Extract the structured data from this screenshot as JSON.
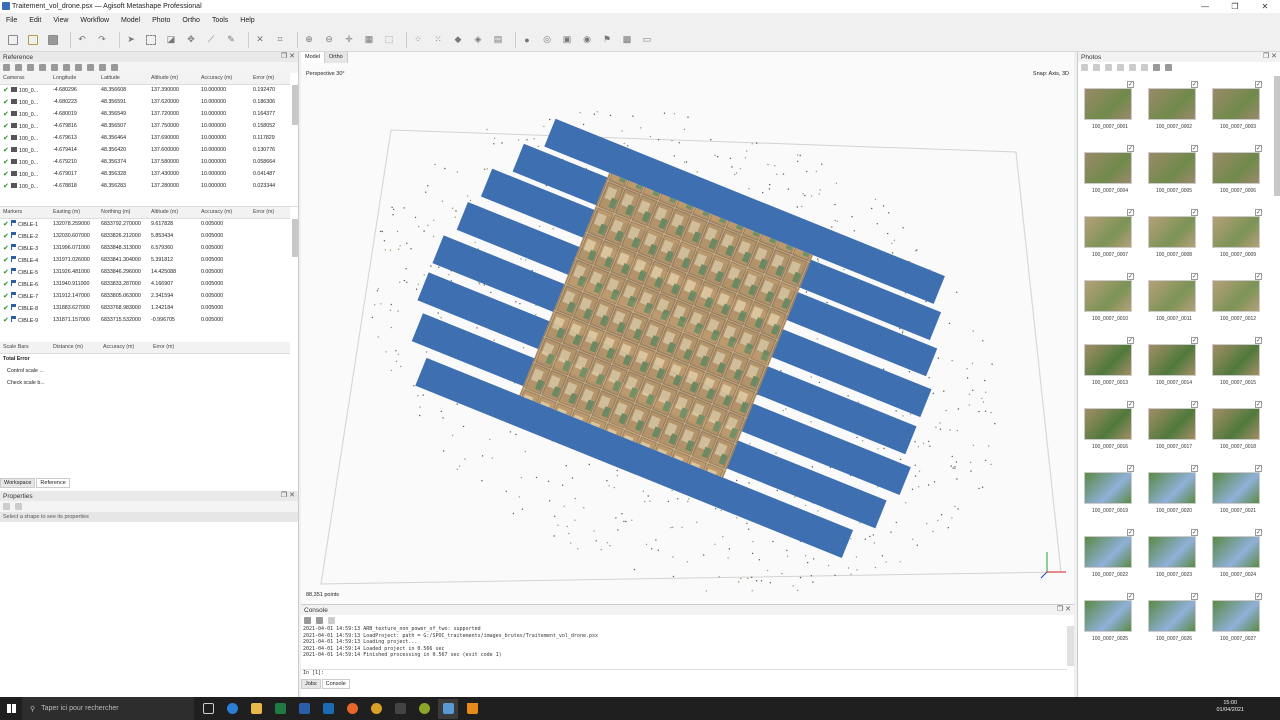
{
  "window": {
    "title": "Traitement_vol_drone.psx — Agisoft Metashape Professional",
    "minimize": "—",
    "maximize": "❐",
    "close": "✕"
  },
  "menu": [
    "File",
    "Edit",
    "View",
    "Workflow",
    "Model",
    "Photo",
    "Ortho",
    "Tools",
    "Help"
  ],
  "reference": {
    "title": "Reference",
    "cameras_headers": [
      "Cameras",
      "Longitude",
      "Latitude",
      "Altitude (m)",
      "Accuracy (m)",
      "Error (m)"
    ],
    "cameras": [
      [
        "100_0...",
        "-4.680296",
        "48.356608",
        "137.390000",
        "10.000000",
        "0.192470"
      ],
      [
        "100_0...",
        "-4.680223",
        "48.356591",
        "137.620000",
        "10.000000",
        "0.186306"
      ],
      [
        "100_0...",
        "-4.680019",
        "48.356549",
        "137.720000",
        "10.000000",
        "0.164377"
      ],
      [
        "100_0...",
        "-4.679816",
        "48.356507",
        "137.750000",
        "10.000000",
        "0.158052"
      ],
      [
        "100_0...",
        "-4.679613",
        "48.356464",
        "137.690000",
        "10.000000",
        "0.117829"
      ],
      [
        "100_0...",
        "-4.679414",
        "48.356420",
        "137.600000",
        "10.000000",
        "0.130776"
      ],
      [
        "100_0...",
        "-4.679210",
        "48.356374",
        "137.580000",
        "10.000000",
        "0.058664"
      ],
      [
        "100_0...",
        "-4.679017",
        "48.356328",
        "137.430000",
        "10.000000",
        "0.041487"
      ],
      [
        "100_0...",
        "-4.678818",
        "48.356283",
        "137.280000",
        "10.000000",
        "0.023344"
      ]
    ],
    "markers_headers": [
      "Markers",
      "Easting (m)",
      "Northing (m)",
      "Altitude (m)",
      "Accuracy (m)",
      "Error (m)"
    ],
    "markers": [
      [
        "CIBLE-1",
        "132078.259000",
        "6833792.270000",
        "9.617828",
        "0.005000",
        ""
      ],
      [
        "CIBLE-2",
        "132030.607000",
        "6833826.212000",
        "5.853434",
        "0.005000",
        ""
      ],
      [
        "CIBLE-3",
        "131996.071000",
        "6833848.313000",
        "6.579360",
        "0.005000",
        ""
      ],
      [
        "CIBLE-4",
        "131971.026000",
        "6833841.304000",
        "5.391812",
        "0.005000",
        ""
      ],
      [
        "CIBLE-5",
        "131926.481000",
        "6833846.296000",
        "14.425088",
        "0.005000",
        ""
      ],
      [
        "CIBLE-6",
        "131940.911000",
        "6833833.287000",
        "4.166907",
        "0.005000",
        ""
      ],
      [
        "CIBLE-7",
        "131912.147000",
        "6833805.063000",
        "2.341594",
        "0.005000",
        ""
      ],
      [
        "CIBLE-8",
        "131883.627000",
        "6833768.983000",
        "1.242184",
        "0.005000",
        ""
      ],
      [
        "CIBLE-9",
        "131871.157000",
        "6833715.532000",
        "-0.996705",
        "0.005000",
        ""
      ]
    ],
    "scalebars_headers": [
      "Scale Bars",
      "Distance (m)",
      "Accuracy (m)",
      "Error (m)"
    ],
    "total_error": "Total Error",
    "control_scale": "Control scale ...",
    "check_scale": "Check scale b..."
  },
  "left_tabs": [
    "Workspace",
    "Reference"
  ],
  "properties": {
    "title": "Properties",
    "hint": "Select a shape to see its properties"
  },
  "viewport": {
    "tabs": [
      "Model",
      "Ortho"
    ],
    "projection": "Perspective 30°",
    "snap": "Snap: Axis, 3D",
    "points": "88,351 points"
  },
  "console": {
    "title": "Console",
    "lines": [
      "2021-04-01 14:59:13 ARB_texture_non_power_of_two: supported",
      "2021-04-01 14:59:13 LoadProject: path = G:/SPOC_traitements/images_brutes/Traitement_vol_drone.psx",
      "2021-04-01 14:59:13 Loading project...",
      "2021-04-01 14:59:14 Loaded project in 0.566 sec",
      "2021-04-01 14:59:14 Finished processing in 0.567 sec (exit code 1)"
    ],
    "prompt": "In [1]:",
    "tabs": [
      "Jobs",
      "Console"
    ]
  },
  "photos": {
    "title": "Photos",
    "items": [
      "100_0007_0001",
      "100_0007_0002",
      "100_0007_0003",
      "100_0007_0004",
      "100_0007_0005",
      "100_0007_0006",
      "100_0007_0007",
      "100_0007_0008",
      "100_0007_0009",
      "100_0007_0010",
      "100_0007_0011",
      "100_0007_0012",
      "100_0007_0013",
      "100_0007_0014",
      "100_0007_0015",
      "100_0007_0016",
      "100_0007_0017",
      "100_0007_0018",
      "100_0007_0019",
      "100_0007_0020",
      "100_0007_0021",
      "100_0007_0022",
      "100_0007_0023",
      "100_0007_0024",
      "100_0007_0025",
      "100_0007_0026",
      "100_0007_0027"
    ]
  },
  "taskbar": {
    "search_placeholder": "Taper ici pour rechercher",
    "time": "15:00",
    "date": "01/04/2021"
  }
}
